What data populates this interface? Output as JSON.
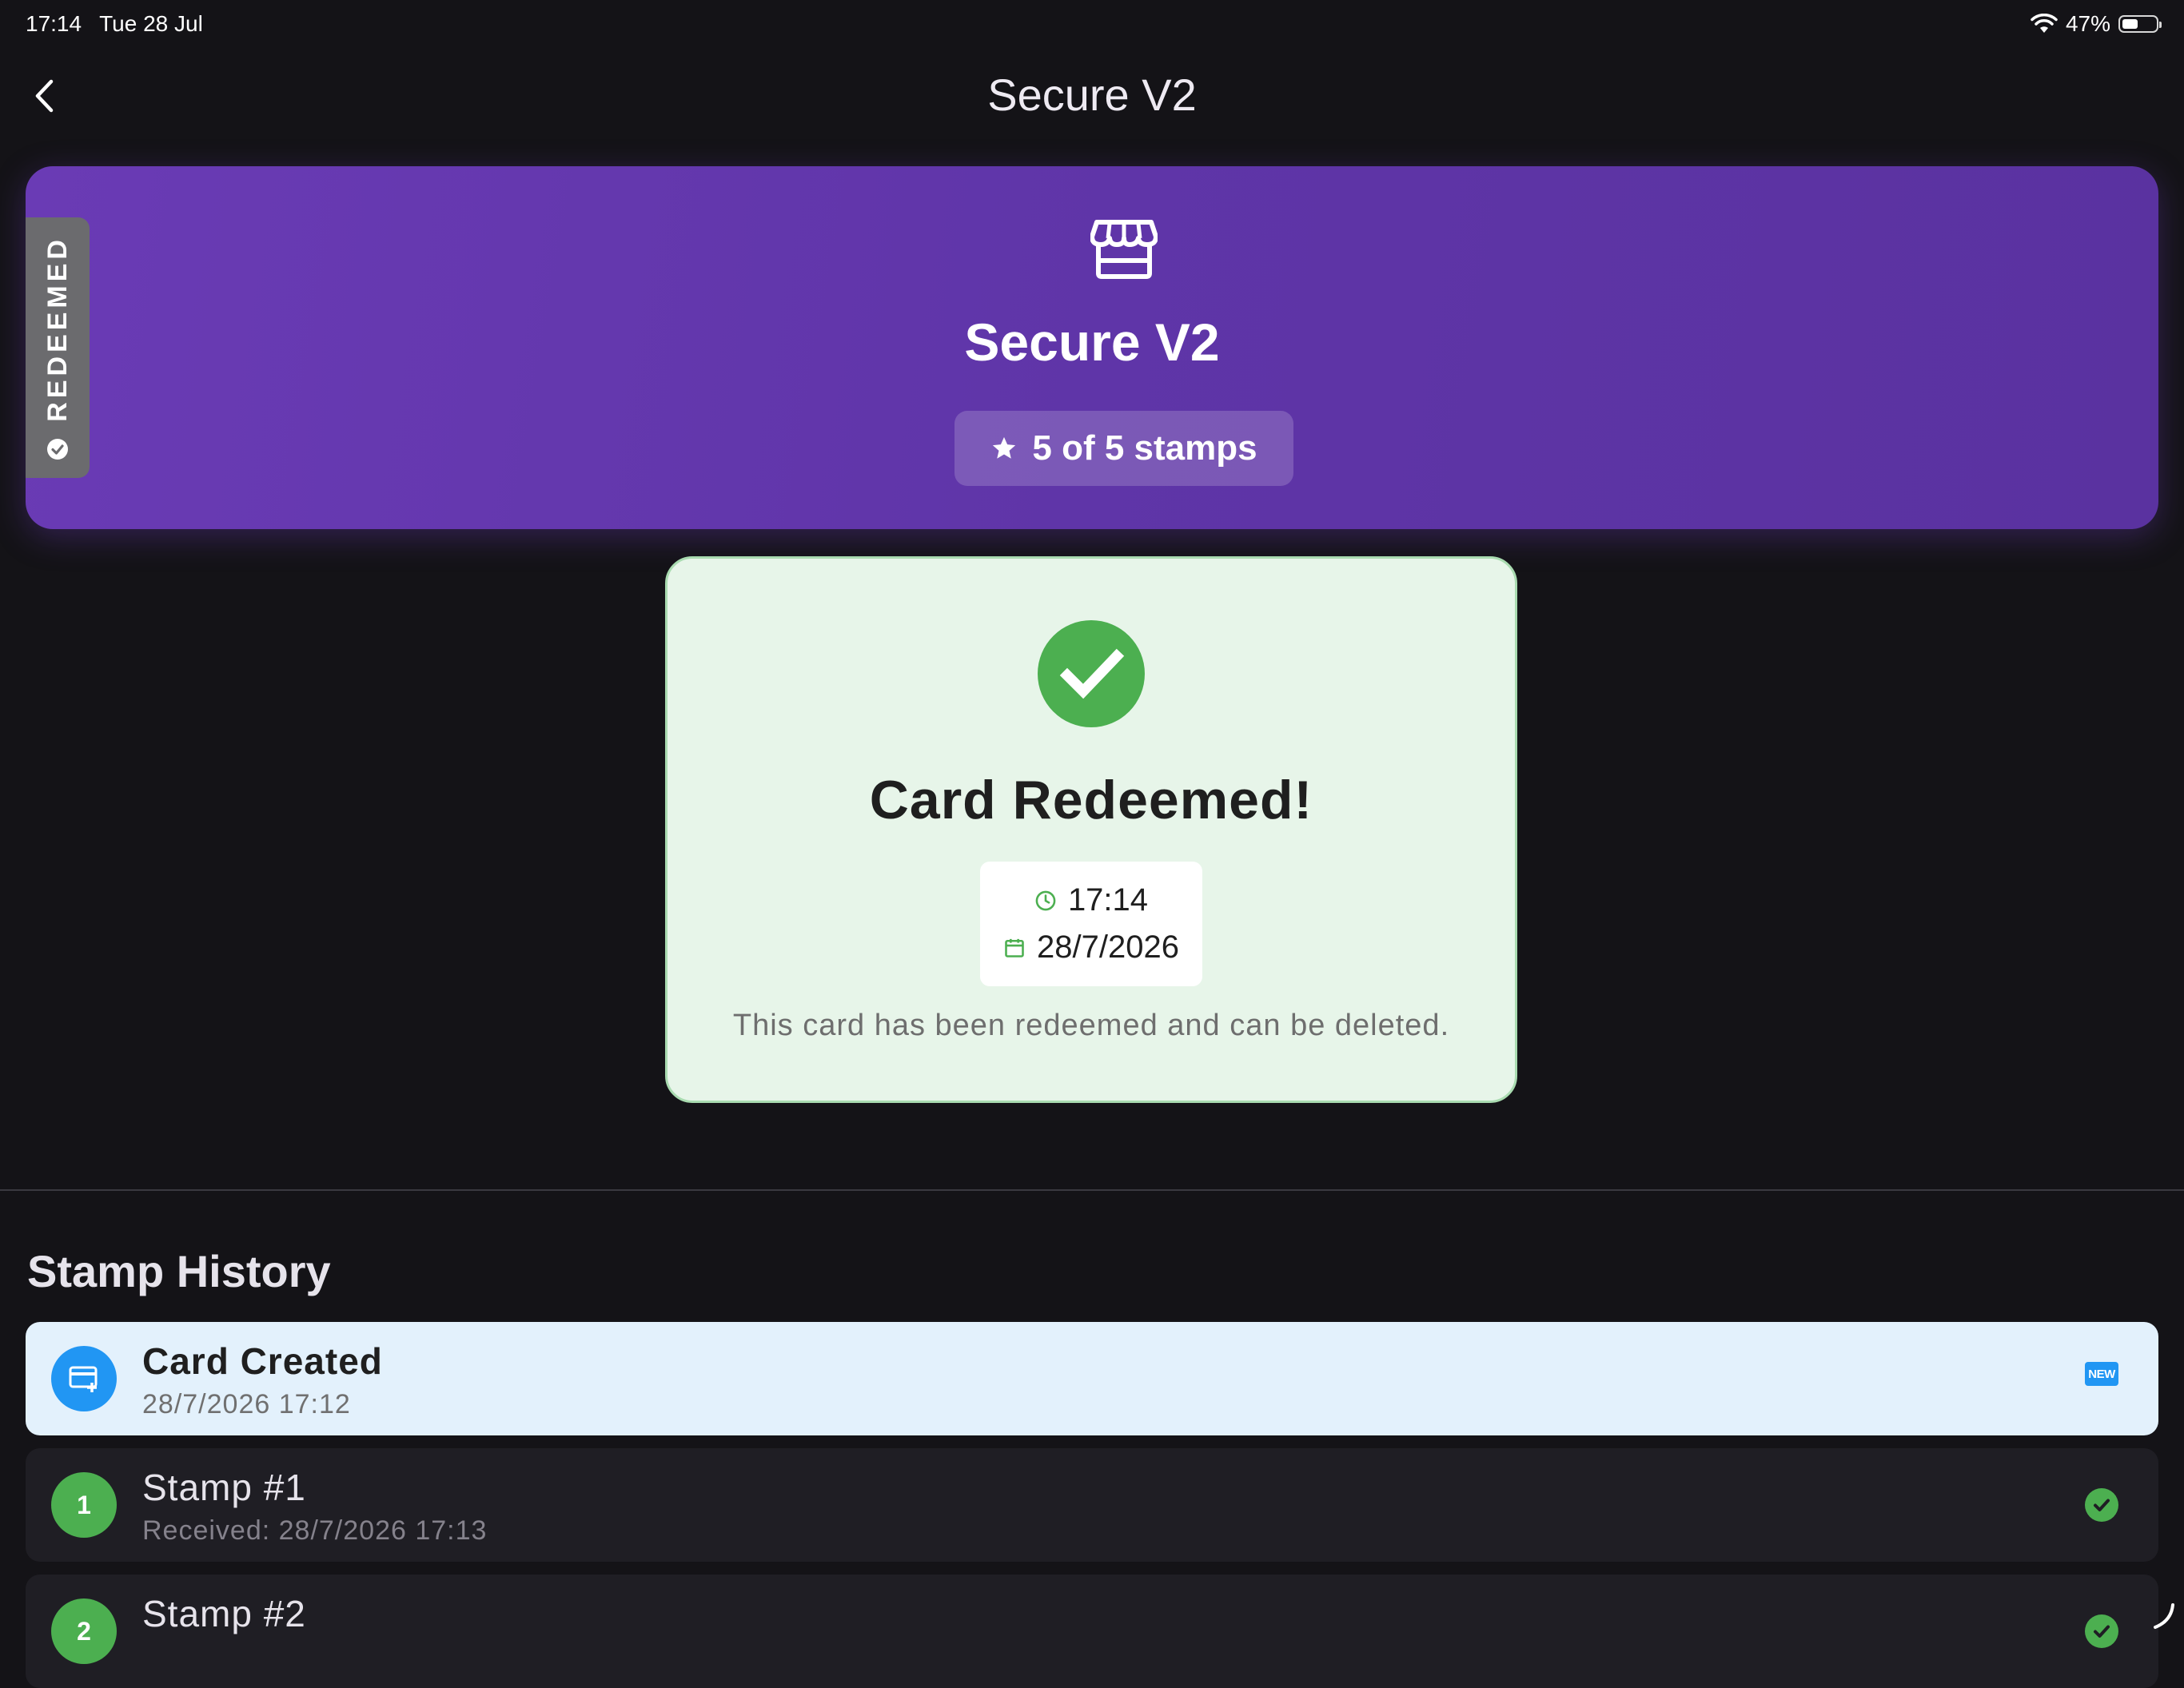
{
  "status_bar": {
    "time": "17:14",
    "date": "Tue 28 Jul",
    "battery": "47%",
    "battery_level": 0.47
  },
  "nav": {
    "title": "Secure V2"
  },
  "card": {
    "redeemed_tag": "REDEEMED",
    "name": "Secure V2",
    "stamps_label": "5 of 5 stamps",
    "gradient_colors": [
      "#6a3bb5",
      "#5a32a0"
    ]
  },
  "redeemed_panel": {
    "title": "Card Redeemed!",
    "time": "17:14",
    "date": "28/7/2026",
    "message": "This card has been redeemed and can be deleted."
  },
  "history": {
    "title": "Stamp History",
    "items": [
      {
        "title": "Card Created",
        "subtitle": "28/7/2026 17:12",
        "badge": "NEW",
        "icon": "card-plus-icon"
      },
      {
        "number": "1",
        "title": "Stamp #1",
        "subtitle": "Received: 28/7/2026 17:13",
        "icon": "check-circle-icon"
      },
      {
        "number": "2",
        "title": "Stamp #2",
        "subtitle": "",
        "icon": "check-circle-icon"
      }
    ]
  },
  "colors": {
    "success": "#4caf50",
    "info": "#2196f3",
    "background": "#141317"
  }
}
